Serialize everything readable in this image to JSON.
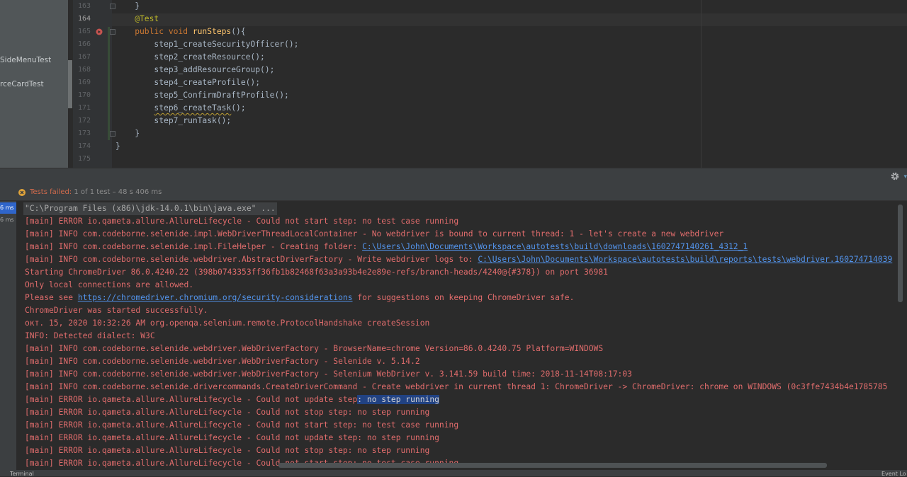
{
  "project": {
    "items": [
      "SideMenuTest",
      "rceCardTest"
    ]
  },
  "editor": {
    "lines": [
      {
        "num": "163",
        "text": "    }"
      },
      {
        "num": "164",
        "text": "    @Test"
      },
      {
        "num": "165",
        "text": "    public void runSteps(){"
      },
      {
        "num": "166",
        "text": "        step1_createSecurityOfficer();"
      },
      {
        "num": "167",
        "text": "        step2_createResource();"
      },
      {
        "num": "168",
        "text": "        step3_addResourceGroup();"
      },
      {
        "num": "169",
        "text": "        step4_createProfile();"
      },
      {
        "num": "170",
        "text": "        step5_ConfirmDraftProfile();"
      },
      {
        "num": "171",
        "text": "        step6_createTask();"
      },
      {
        "num": "172",
        "text": "        step7_runTask();"
      },
      {
        "num": "173",
        "text": "    }"
      },
      {
        "num": "174",
        "text": "}"
      },
      {
        "num": "175",
        "text": ""
      }
    ]
  },
  "run": {
    "status_failed": "Tests failed:",
    "status_detail": "1 of 1 test – 48 s 406 ms",
    "tree_times": [
      "6 ms",
      "6 ms"
    ],
    "console": {
      "cmd": "\"C:\\Program Files (x86)\\jdk-14.0.1\\bin\\java.exe\" ...",
      "l1": "[main] ERROR io.qameta.allure.AllureLifecycle - Could not start step: no test case running",
      "l2": "[main] INFO com.codeborne.selenide.impl.WebDriverThreadLocalContainer - No webdriver is bound to current thread: 1 - let's create a new webdriver",
      "l3_pre": "[main] INFO com.codeborne.selenide.impl.FileHelper - Creating folder: ",
      "l3_link": "C:\\Users\\John\\Documents\\Workspace\\autotests\\build\\downloads\\1602747140261_4312_1",
      "l4_pre": "[main] INFO com.codeborne.selenide.webdriver.AbstractDriverFactory - Write webdriver logs to: ",
      "l4_link": "C:\\Users\\John\\Documents\\Workspace\\autotests\\build\\reports\\tests\\webdriver.160274714039",
      "l5": "Starting ChromeDriver 86.0.4240.22 (398b0743353ff36fb1b82468f63a3a93b4e2e89e-refs/branch-heads/4240@{#378}) on port 36981",
      "l6": "Only local connections are allowed.",
      "l7_pre": "Please see ",
      "l7_link": "https://chromedriver.chromium.org/security-considerations",
      "l7_post": " for suggestions on keeping ChromeDriver safe.",
      "l8": "ChromeDriver was started successfully.",
      "l9": "окт. 15, 2020 10:32:26 AM org.openqa.selenium.remote.ProtocolHandshake createSession",
      "l10": "INFO: Detected dialect: W3C",
      "l11": "[main] INFO com.codeborne.selenide.webdriver.WebDriverFactory - BrowserName=chrome Version=86.0.4240.75 Platform=WINDOWS",
      "l12": "[main] INFO com.codeborne.selenide.webdriver.WebDriverFactory - Selenide v. 5.14.2",
      "l13": "[main] INFO com.codeborne.selenide.webdriver.WebDriverFactory - Selenium WebDriver v. 3.141.59 build time: 2018-11-14T08:17:03",
      "l14": "[main] INFO com.codeborne.selenide.drivercommands.CreateDriverCommand - Create webdriver in current thread 1: ChromeDriver -> ChromeDriver: chrome on WINDOWS (0c3ffe7434b4e1785785",
      "l15_pre": "[main] ERROR io.qameta.allure.AllureLifecycle - Could not update step",
      "l15_hl": ": no step running",
      "l16": "[main] ERROR io.qameta.allure.AllureLifecycle - Could not stop step: no step running",
      "l17": "[main] ERROR io.qameta.allure.AllureLifecycle - Could not start step: no test case running",
      "l18": "[main] ERROR io.qameta.allure.AllureLifecycle - Could not update step: no step running",
      "l19": "[main] ERROR io.qameta.allure.AllureLifecycle - Could not stop step: no step running",
      "l20": "[main] ERROR io.qameta.allure.AllureLifecycle - Could not start step: no test case running"
    }
  },
  "bottom": {
    "terminal": "Terminal",
    "event_log": "Event Lo"
  },
  "colors": {
    "error_text": "#e06c6c",
    "link": "#5394ec",
    "selection": "#214283"
  }
}
